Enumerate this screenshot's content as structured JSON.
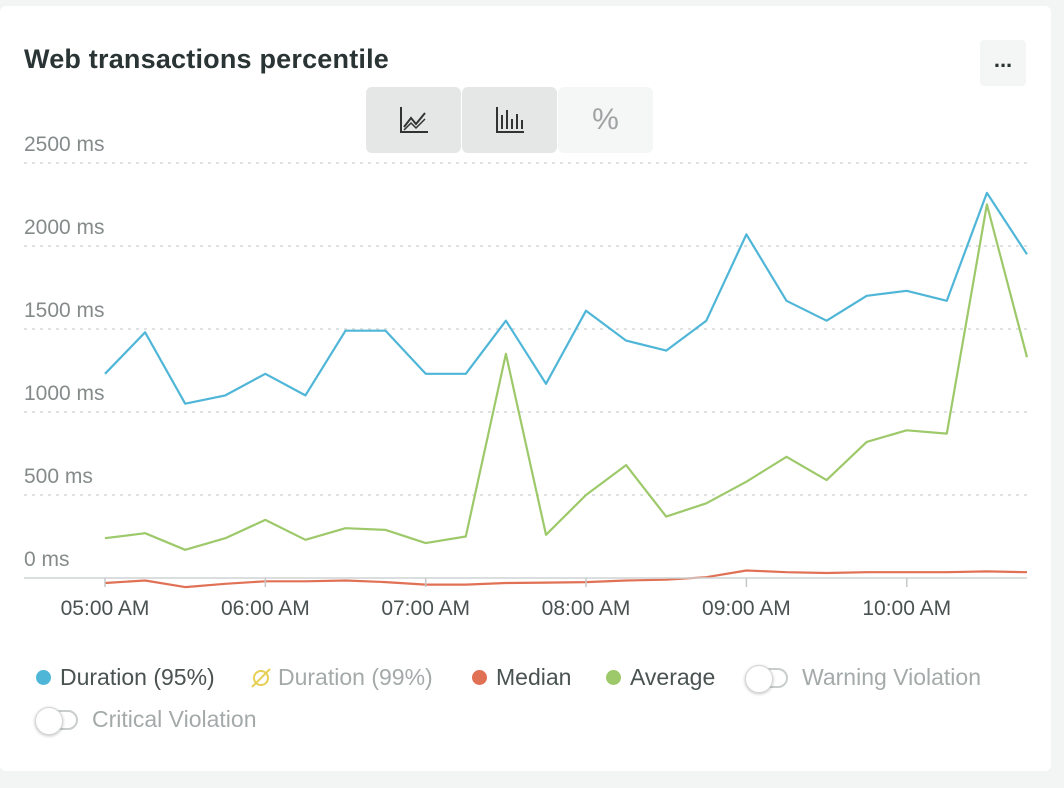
{
  "widget": {
    "title": "Web transactions percentile",
    "more_label": "...",
    "toggles": [
      {
        "name": "line-chart",
        "icon": "line-chart-icon",
        "active": true
      },
      {
        "name": "bar-chart",
        "icon": "bar-chart-icon",
        "active": true
      },
      {
        "name": "percent",
        "label": "%",
        "active": false
      }
    ]
  },
  "legend": {
    "items": [
      {
        "name": "Duration (95%)",
        "color": "#4fb6d8",
        "type": "dot",
        "muted": false
      },
      {
        "name": "Duration (99%)",
        "color": "#e6cf52",
        "type": "disabled",
        "muted": true
      },
      {
        "name": "Median",
        "color": "#e07155",
        "type": "dot",
        "muted": false
      },
      {
        "name": "Average",
        "color": "#9dc96a",
        "type": "dot",
        "muted": false
      },
      {
        "name": "Warning Violation",
        "type": "switch",
        "muted": true
      },
      {
        "name": "Critical Violation",
        "type": "switch",
        "muted": true
      }
    ]
  },
  "chart_data": {
    "type": "line",
    "ylim": [
      0,
      2500
    ],
    "yticks": [
      0,
      500,
      1000,
      1500,
      2000,
      2500
    ],
    "ytick_labels": [
      "0 ms",
      "500 ms",
      "1000 ms",
      "1500 ms",
      "2000 ms",
      "2500 ms"
    ],
    "xtick_labels": [
      "05:00 AM",
      "06:00 AM",
      "07:00 AM",
      "08:00 AM",
      "09:00 AM",
      "10:00 AM"
    ],
    "x_minutes_from_0500": [
      0,
      15,
      30,
      45,
      60,
      75,
      90,
      105,
      120,
      135,
      150,
      165,
      180,
      195,
      210,
      225,
      240,
      255,
      270,
      285,
      300,
      315,
      330,
      345
    ],
    "grid": true,
    "legend_position": "bottom",
    "series": [
      {
        "name": "Duration (95%)",
        "color": "#4fb6d8",
        "values": [
          1230,
          1480,
          1050,
          1100,
          1230,
          1100,
          1490,
          1490,
          1230,
          1230,
          1550,
          1170,
          1610,
          1430,
          1370,
          1550,
          2070,
          1670,
          1550,
          1700,
          1730,
          1670,
          2320,
          1950
        ]
      },
      {
        "name": "Median",
        "color": "#e07155",
        "values": [
          -30,
          -15,
          -55,
          -35,
          -20,
          -20,
          -15,
          -25,
          -40,
          -40,
          -30,
          -28,
          -25,
          -15,
          -10,
          5,
          45,
          35,
          30,
          35,
          35,
          35,
          40,
          35
        ]
      },
      {
        "name": "Average",
        "color": "#9dc96a",
        "values": [
          240,
          270,
          170,
          240,
          350,
          230,
          300,
          290,
          210,
          250,
          1350,
          260,
          500,
          680,
          370,
          450,
          580,
          730,
          590,
          820,
          890,
          870,
          2250,
          1330
        ]
      }
    ]
  }
}
